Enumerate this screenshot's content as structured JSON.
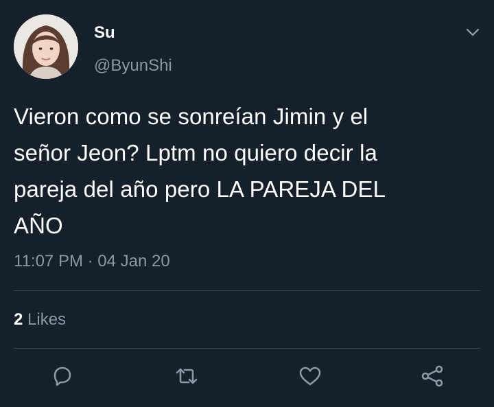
{
  "user": {
    "display_name": "Su",
    "handle": "@ByunShi"
  },
  "tweet": {
    "text": "Vieron como se sonreían Jimin y el\nseñor Jeon? Lptm no quiero decir la\npareja del año pero LA PAREJA DEL\nAÑO",
    "time": "11:07 PM",
    "separator": "·",
    "date": "04 Jan 20"
  },
  "stats": {
    "likes_count": "2",
    "likes_label": "Likes"
  },
  "actions": [
    {
      "icon": "reply-icon"
    },
    {
      "icon": "retweet-icon"
    },
    {
      "icon": "heart-icon"
    },
    {
      "icon": "share-icon"
    }
  ],
  "colors": {
    "background": "#15202b",
    "primary_text": "#ffffff",
    "secondary_text": "#8899a6",
    "divider": "#38444d"
  }
}
